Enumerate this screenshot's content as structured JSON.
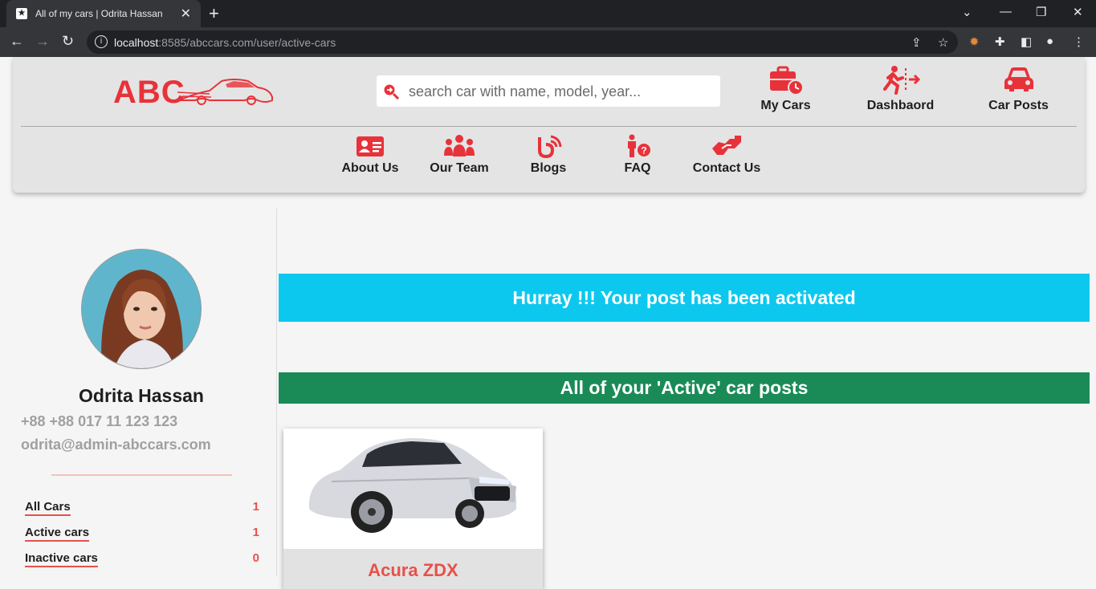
{
  "browser": {
    "tab_title": "All of my cars | Odrita Hassan",
    "url_host": "localhost",
    "url_rest": ":8585/abccars.com/user/active-cars"
  },
  "header": {
    "logo_text": "ABC",
    "search_placeholder": "search car with name, model, year...",
    "top_nav": [
      {
        "label": "My Cars",
        "icon": "briefcase-clock-icon"
      },
      {
        "label": "Dashbaord",
        "icon": "exit-runner-icon"
      },
      {
        "label": "Car Posts",
        "icon": "car-front-icon"
      }
    ],
    "sub_nav": [
      {
        "label": "About Us",
        "icon": "id-card-icon"
      },
      {
        "label": "Our Team",
        "icon": "team-icon"
      },
      {
        "label": "Blogs",
        "icon": "blog-icon"
      },
      {
        "label": "FAQ",
        "icon": "question-person-icon"
      },
      {
        "label": "Contact Us",
        "icon": "handshake-icon"
      }
    ]
  },
  "profile": {
    "name": "Odrita Hassan",
    "phone": "+88 +88 017 11 123 123",
    "email": "odrita@admin-abccars.com",
    "stats": [
      {
        "label": "All Cars",
        "count": "1"
      },
      {
        "label": "Active cars",
        "count": "1"
      },
      {
        "label": "Inactive cars",
        "count": "0"
      }
    ]
  },
  "main": {
    "activated_message": "Hurray !!! Your post has been activated",
    "section_title": "All of your 'Active' car posts",
    "cars": [
      {
        "name": "Acura ZDX"
      }
    ]
  },
  "colors": {
    "brand_red": "#e8323a",
    "info_cyan": "#0dc8ee",
    "success_green": "#1a8b57"
  }
}
